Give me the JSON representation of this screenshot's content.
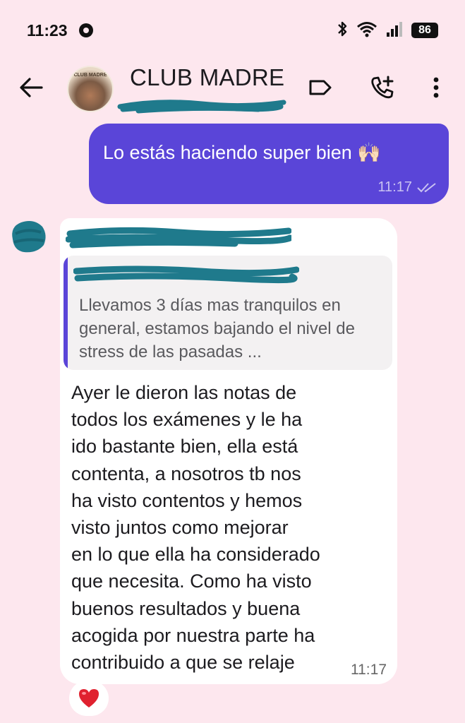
{
  "status_bar": {
    "time": "11:23",
    "battery": "86"
  },
  "header": {
    "title": "CLUB MADRE",
    "subtitle": "",
    "avatar_text": "CLUB MADRE"
  },
  "icons": {
    "back": "arrow-left-icon",
    "label": "tag-icon",
    "call": "add-call-icon",
    "menu": "more-vert-icon",
    "notification": "message-bubble-icon",
    "bluetooth": "bluetooth-icon",
    "wifi": "wifi-icon",
    "signal": "signal-icon",
    "read": "double-check-icon",
    "reaction": "heart-emoji"
  },
  "outgoing_message": {
    "text": "Lo estás haciendo super bien 🙌🏻",
    "time": "11:17"
  },
  "incoming_message": {
    "quote_text": "Llevamos 3 días mas tranquilos en general, estamos bajando el nivel de stress de las pasadas ...",
    "lines": [
      "Ayer le dieron las notas de",
      "todos los exámenes y le ha",
      "ido bastante bien, ella está",
      "contenta, a nosotros tb nos",
      "ha visto contentos y hemos",
      "visto juntos como mejorar",
      "en lo que ella ha considerado",
      "que necesita. Como ha visto",
      "buenos resultados y buena",
      "acogida por nuestra parte ha",
      "contribuido a que se relaje"
    ],
    "time": "11:17",
    "reaction": "❤️"
  },
  "colors": {
    "background": "#fde7ee",
    "accent": "#5a45d8",
    "redaction": "#1f7a8c",
    "incoming_bubble": "#ffffff"
  }
}
